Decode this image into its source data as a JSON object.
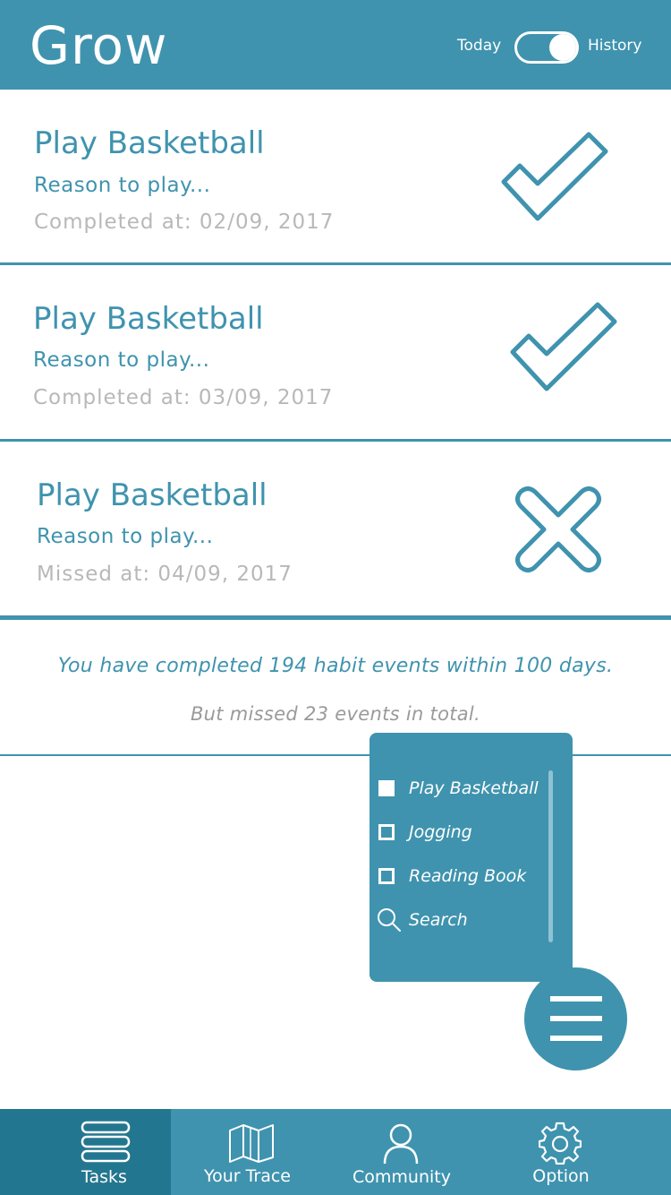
{
  "header": {
    "title": "Grow",
    "toggle": {
      "left_label": "Today",
      "right_label": "History",
      "state": "History"
    }
  },
  "events": [
    {
      "title": "Play Basketball",
      "reason": "Reason to play...",
      "date_text": "Completed at: 02/09, 2017",
      "status": "completed",
      "icon": "checkmark-icon"
    },
    {
      "title": "Play Basketball",
      "reason": "Reason to play...",
      "date_text": "Completed at: 03/09, 2017",
      "status": "completed",
      "icon": "checkmark-icon"
    },
    {
      "title": "Play Basketball",
      "reason": "Reason to play...",
      "date_text": "Missed at: 04/09, 2017",
      "status": "missed",
      "icon": "x-mark-icon"
    }
  ],
  "summary": {
    "completed_text": "You have completed 194 habit events within 100 days.",
    "missed_text": "But missed 23 events in total."
  },
  "filter_menu": {
    "items": [
      {
        "label": "Play Basketball",
        "checked": true,
        "icon": "checkbox-checked-icon"
      },
      {
        "label": "Jogging",
        "checked": false,
        "icon": "checkbox-empty-icon"
      },
      {
        "label": "Reading Book",
        "checked": false,
        "icon": "checkbox-empty-icon"
      },
      {
        "label": "Search",
        "icon": "search-icon"
      }
    ]
  },
  "fab": {
    "icon": "hamburger-menu-icon"
  },
  "tabbar": {
    "active": "Tasks",
    "tabs": [
      {
        "label": "Tasks",
        "icon": "stack-icon"
      },
      {
        "label": "Your Trace",
        "icon": "map-icon"
      },
      {
        "label": "Community",
        "icon": "user-icon"
      },
      {
        "label": "Option",
        "icon": "gear-icon"
      }
    ]
  },
  "colors": {
    "primary": "#3f93ae",
    "active_tab": "#23768f",
    "muted_text": "#b8b8b8",
    "background": "#ffffff"
  }
}
